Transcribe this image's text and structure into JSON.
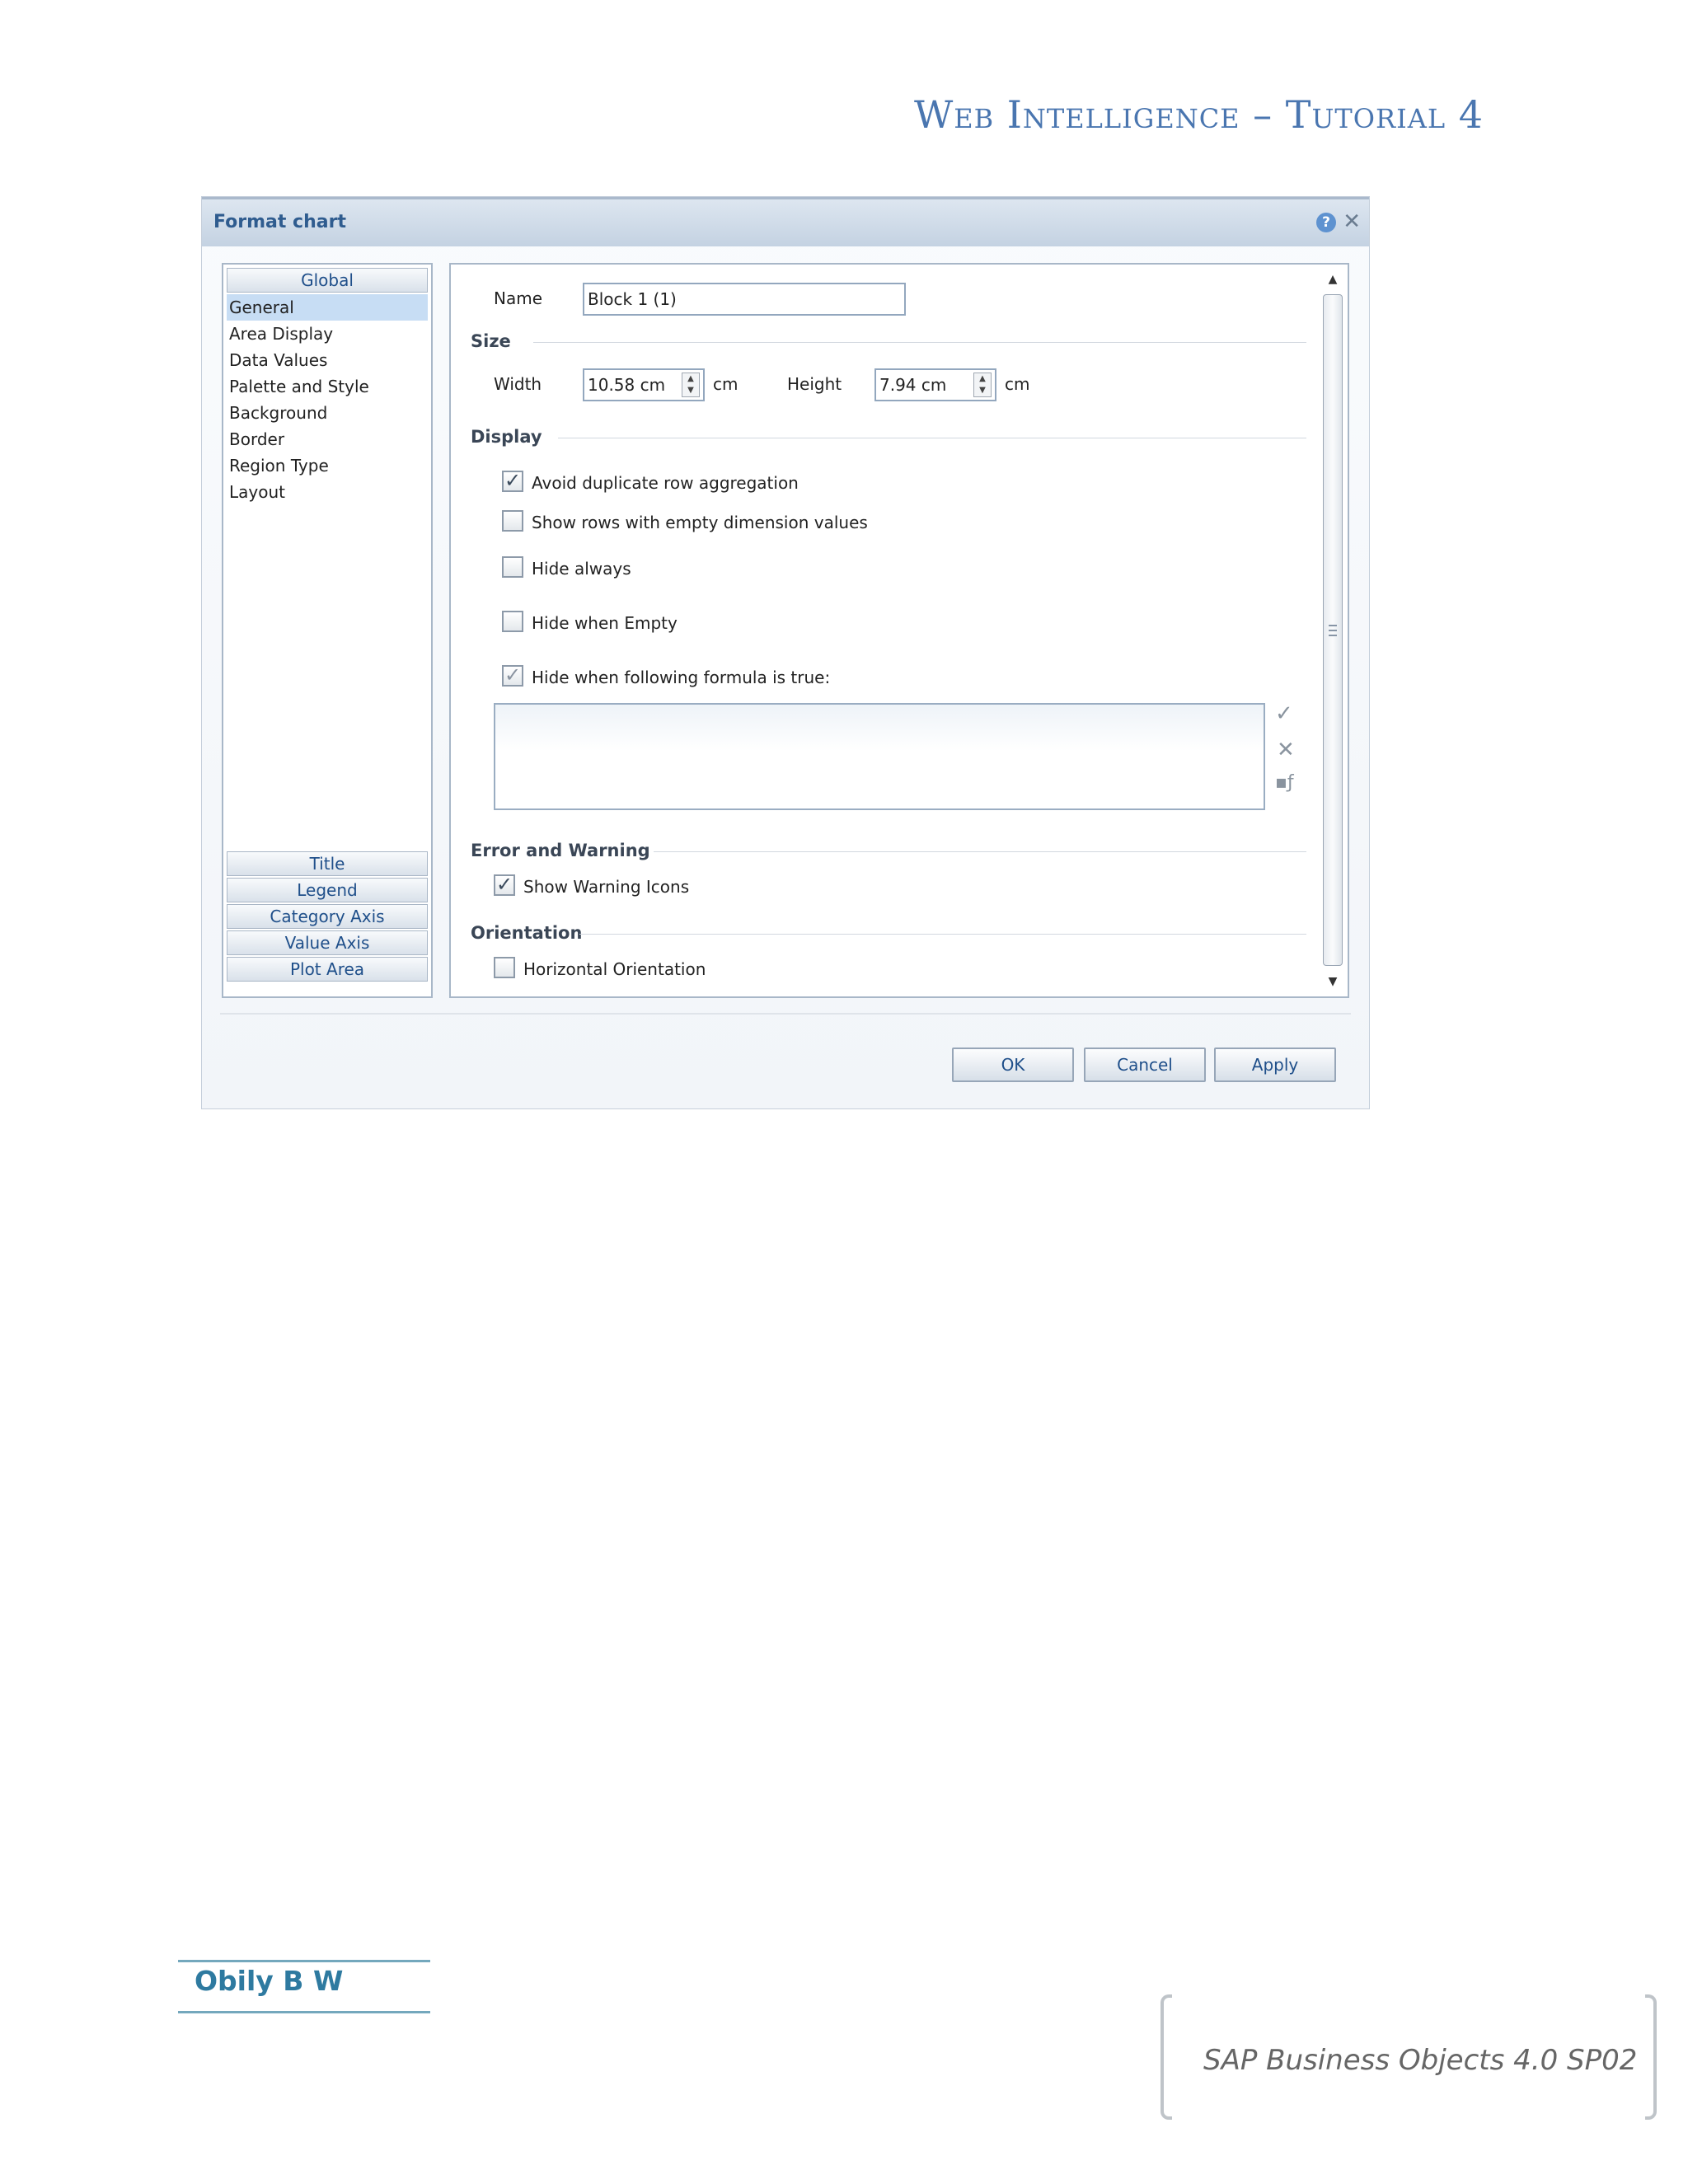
{
  "page": {
    "header": "Web Intelligence – Tutorial 4",
    "author": "Obily B W",
    "product": "SAP Business Objects 4.0 SP02"
  },
  "dialog": {
    "title": "Format chart",
    "help_icon": "?",
    "close_icon": "✕",
    "left_panel": {
      "global_label": "Global",
      "items": [
        "General",
        "Area Display",
        "Data Values",
        "Palette and Style",
        "Background",
        "Border",
        "Region Type",
        "Layout"
      ],
      "selected": "General",
      "sections": [
        "Title",
        "Legend",
        "Category Axis",
        "Value Axis",
        "Plot Area"
      ]
    },
    "general": {
      "name_label": "Name",
      "name_value": "Block 1 (1)",
      "size_title": "Size",
      "width_label": "Width",
      "width_value": "10.58 cm",
      "width_unit": "cm",
      "height_label": "Height",
      "height_value": "7.94 cm",
      "height_unit": "cm",
      "display_title": "Display",
      "avoid_duplicate": "Avoid duplicate row aggregation",
      "show_empty_rows": "Show rows with empty dimension values",
      "hide_always": "Hide always",
      "hide_when_empty": "Hide when Empty",
      "hide_formula": "Hide when following formula is true:",
      "error_title": "Error and Warning",
      "show_warning": "Show Warning Icons",
      "orientation_title": "Orientation",
      "horizontal": "Horizontal Orientation"
    },
    "checkbox_states": {
      "avoid_duplicate": true,
      "show_empty_rows": false,
      "hide_always": false,
      "hide_when_empty": false,
      "hide_formula": true,
      "show_warning": true,
      "horizontal": false
    },
    "buttons": {
      "ok": "OK",
      "cancel": "Cancel",
      "apply": "Apply"
    },
    "icons": {
      "validate": "checkmark-icon",
      "clear": "x-icon",
      "formula_editor": "formula-editor-icon"
    },
    "colors": {
      "header_text": "#4a76b0",
      "selected_item": "#c7ddf4",
      "title_text": "#2f5c8f"
    }
  }
}
